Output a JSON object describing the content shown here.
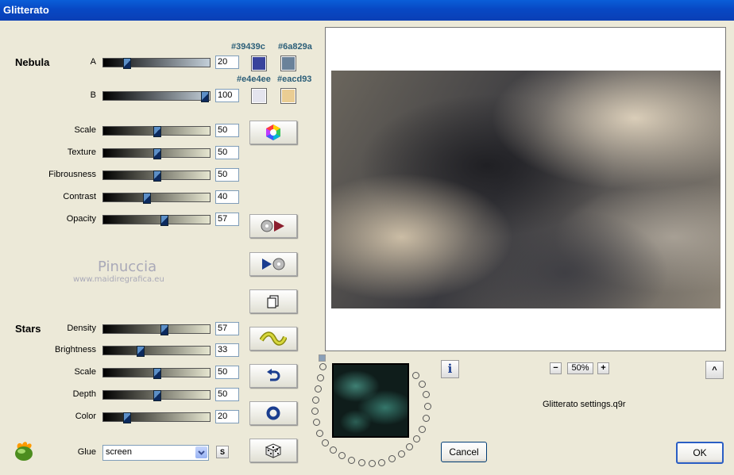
{
  "window": {
    "title": "Glitterato"
  },
  "nebula": {
    "section_label": "Nebula",
    "sliders": [
      {
        "label": "A",
        "value": "20",
        "level": 0.22,
        "style": "blue"
      },
      {
        "label": "B",
        "value": "100",
        "level": 0.95,
        "style": "blue"
      },
      {
        "label": "Scale",
        "value": "50",
        "level": 0.5,
        "style": "warm"
      },
      {
        "label": "Texture",
        "value": "50",
        "level": 0.5,
        "style": "warm"
      },
      {
        "label": "Fibrousness",
        "value": "50",
        "level": 0.5,
        "style": "warm"
      },
      {
        "label": "Contrast",
        "value": "40",
        "level": 0.4,
        "style": "warm"
      },
      {
        "label": "Opacity",
        "value": "57",
        "level": 0.57,
        "style": "warm"
      }
    ],
    "colors": [
      {
        "hex_label": "#39439c",
        "color": "#39439c"
      },
      {
        "hex_label": "#6a829a",
        "color": "#6a829a"
      },
      {
        "hex_label": "#e4e4ee",
        "color": "#e4e4ee"
      },
      {
        "hex_label": "#eacd93",
        "color": "#eacd93"
      }
    ]
  },
  "stars": {
    "section_label": "Stars",
    "sliders": [
      {
        "label": "Density",
        "value": "57",
        "level": 0.57
      },
      {
        "label": "Brightness",
        "value": "33",
        "level": 0.34
      },
      {
        "label": "Scale",
        "value": "50",
        "level": 0.5
      },
      {
        "label": "Depth",
        "value": "50",
        "level": 0.5
      },
      {
        "label": "Color",
        "value": "20",
        "level": 0.22
      }
    ]
  },
  "watermark": {
    "line1": "Pinuccia",
    "line2": "www.maidiregrafica.eu"
  },
  "glue": {
    "label": "Glue",
    "value": "screen",
    "s_button": "S"
  },
  "zoom": {
    "minus": "−",
    "value": "50%",
    "plus": "+"
  },
  "info_button": "i",
  "up_button": "^",
  "settings_file": "Glitterato settings.q9r",
  "buttons": {
    "cancel": "Cancel",
    "ok": "OK"
  },
  "icons": {
    "color_wheel": "color-wheel-icon",
    "save_preset": "save-preset-icon",
    "load_preset": "load-preset-icon",
    "copy": "copy-icon",
    "wave": "wave-icon",
    "undo": "undo-icon",
    "reset": "ring-icon",
    "random": "dice-icon",
    "app_logo": "app-logo-icon"
  }
}
